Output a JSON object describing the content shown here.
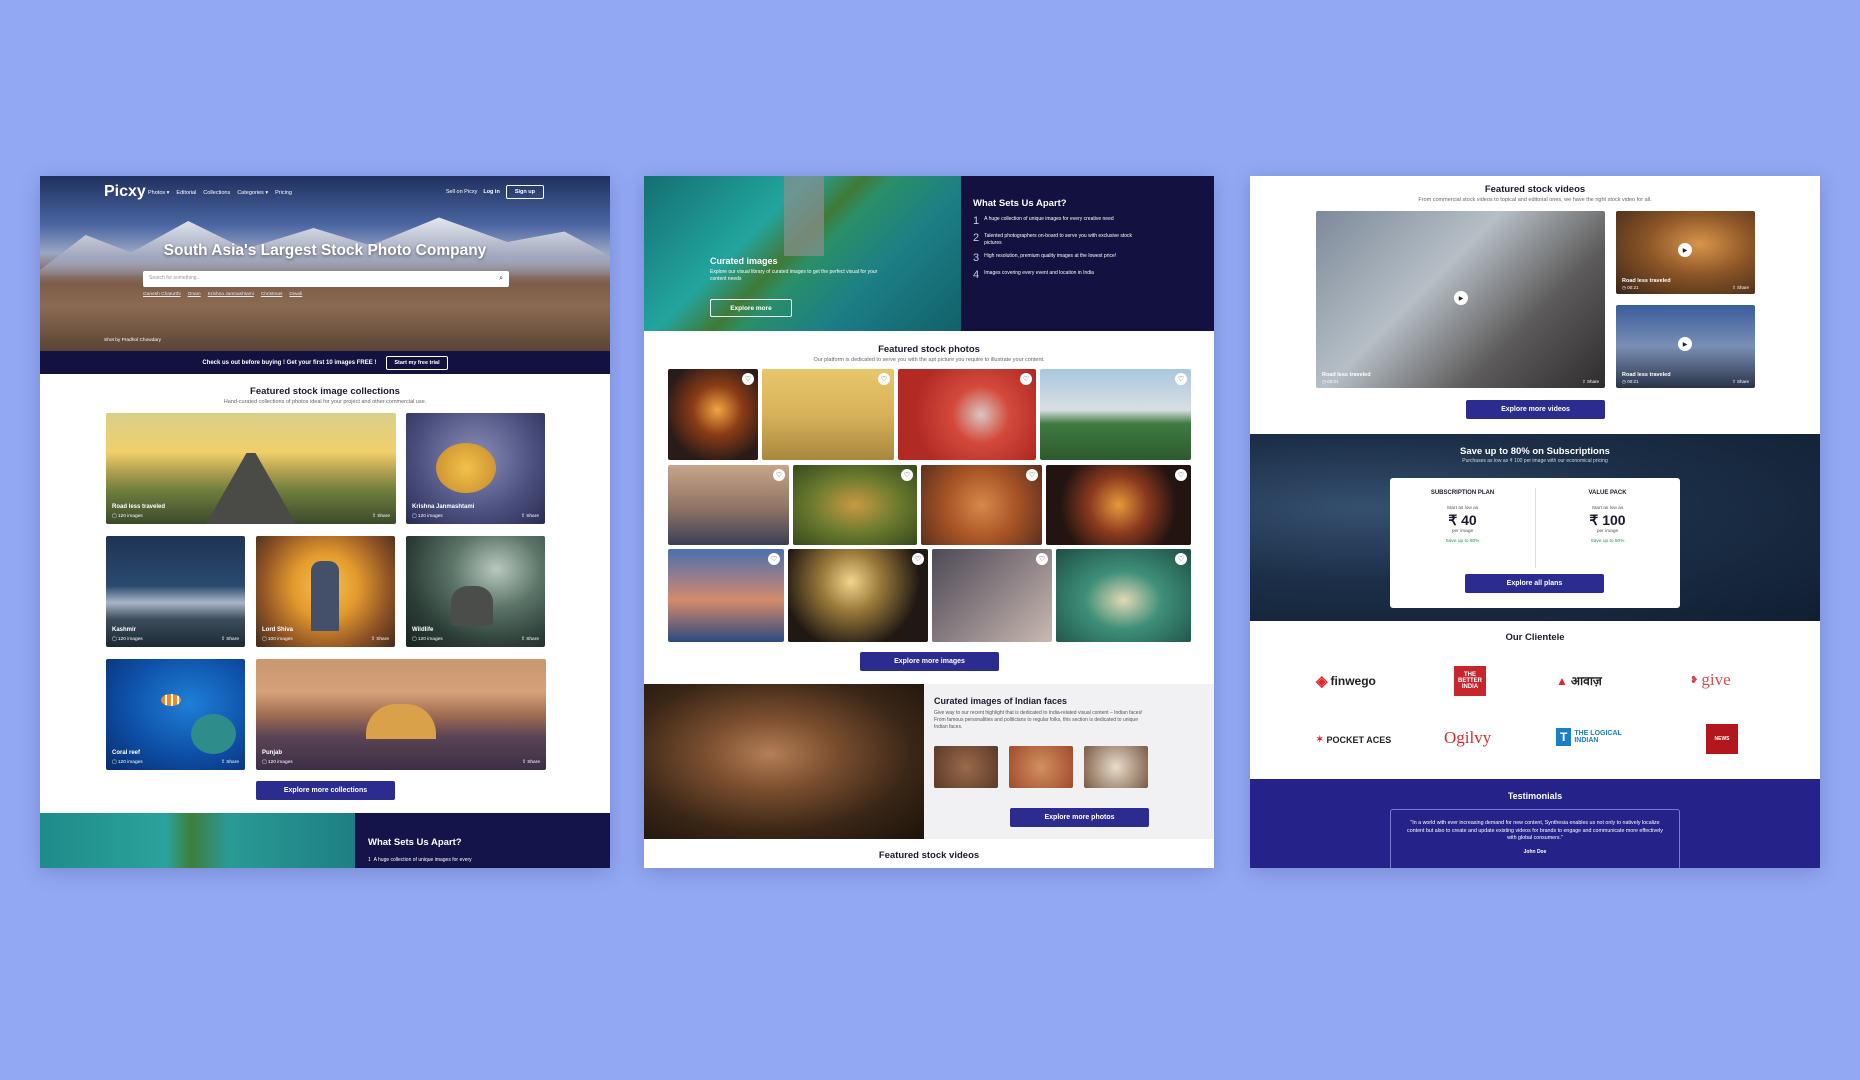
{
  "brand": {
    "logo": "Picxy",
    "watermark": "Picxy"
  },
  "nav": {
    "items": [
      "Photos ▾",
      "Editorial",
      "Collections",
      "Categories ▾",
      "Pricing"
    ],
    "sell": "Sell on Picxy",
    "login": "Log in",
    "signup": "Sign up"
  },
  "hero": {
    "title": "South Asia's Largest Stock Photo Company",
    "search_placeholder": "Search for something...",
    "tags": [
      "Ganesh Chaturthi",
      "Onam",
      "Krishna Janmashtami",
      "Christmas",
      "Diwali"
    ],
    "credit": "Shot by Pradhol Chowdary"
  },
  "promo": {
    "text": "Check us out before buying ! Get your first 10 images FREE !",
    "button": "Start my free trial"
  },
  "collections": {
    "title": "Featured stock image collections",
    "subtitle": "Hand-curated collections of photos ideal for your project and other commercial use.",
    "share": "Share",
    "items": [
      {
        "name": "Road less traveled",
        "count": "120 images"
      },
      {
        "name": "Krishna Janmashtami",
        "count": "120 images"
      },
      {
        "name": "Kashmir",
        "count": "120 images"
      },
      {
        "name": "Lord Shiva",
        "count": "100 images"
      },
      {
        "name": "Wildlife",
        "count": "120 images"
      },
      {
        "name": "Coral reef",
        "count": "120 images"
      },
      {
        "name": "Punjab",
        "count": "120 images"
      }
    ],
    "button": "Explore more collections"
  },
  "apart": {
    "title": "What Sets Us Apart?",
    "items": [
      "A huge collection of unique images for every creative need",
      "Talented photographers on-board to serve you with exclusive stock pictures",
      "High resolution, premium quality images at the lowest price!",
      "Images covering every event and location in India"
    ],
    "short": "A huge collection of unique images for every"
  },
  "curated": {
    "title": "Curated images",
    "desc": "Explore our visual library of curated images to get the perfect visual for your content needs",
    "button": "Explore more"
  },
  "photos": {
    "title": "Featured stock photos",
    "subtitle": "Our platform is dedicated to serve you with the apt picture you require to illustrate your content.",
    "button": "Explore more images",
    "heart": "♡"
  },
  "faces": {
    "title": "Curated images of Indian faces",
    "desc": "Give way to our recent highlight that is dedicated to India-related visual content – Indian faces! From famous personalities and politicians to regular folks, this section is dedicated to unique Indian faces.",
    "button": "Explore more photos"
  },
  "videos": {
    "title": "Featured stock videos",
    "subtitle": "From commercial stock videos to topical and editorial ones, we have the right stock video for all.",
    "items": [
      {
        "name": "Road less traveled",
        "dur": "00:21"
      },
      {
        "name": "Road less traveled",
        "dur": "00:21"
      },
      {
        "name": "Road less traveled",
        "dur": "00:21"
      }
    ],
    "share": "Share",
    "button": "Explore more videos"
  },
  "subs": {
    "title": "Save up to 80% on Subscriptions",
    "subtitle": "Purchases as low as ₹ 100 per image with our economical pricing",
    "plans": [
      {
        "name": "SUBSCRIPTION PLAN",
        "start": "Start as low as",
        "price": "₹ 40",
        "per": "per image",
        "save": "Save up to 80%"
      },
      {
        "name": "VALUE PACK",
        "start": "Start as low as",
        "price": "₹ 100",
        "per": "per image",
        "save": "Save up to 50%"
      }
    ],
    "button": "Explore all plans"
  },
  "clients": {
    "title": "Our Clientele",
    "logos": [
      "finwego",
      "THE BETTER INDIA",
      "आवाज़",
      "give",
      "POCKET ACES",
      "Ogilvy",
      "THE LOGICAL INDIAN",
      "NEWS"
    ]
  },
  "testimonials": {
    "title": "Testimonials",
    "quote": "\"In a world with ever increasing demand for new content, Synthesia enables us not only to natively localize content but also to create and update existing videos for brands to engage and communicate more effectively with global consumers.\"",
    "author": "John Doe"
  },
  "colors": {
    "background": "#93a8f3",
    "navy": "#12113f",
    "button": "#2c2b8f",
    "save_green": "#1c9b3c"
  }
}
